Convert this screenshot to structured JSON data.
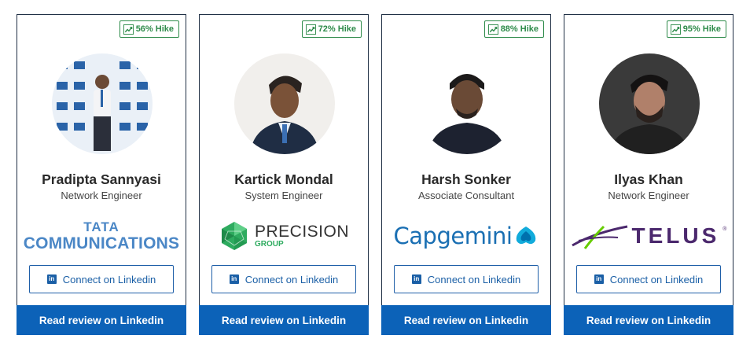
{
  "cards": [
    {
      "hike": "56% Hike",
      "name": "Pradipta Sannyasi",
      "role": "Network Engineer",
      "company_logo": "TATA COMMUNICATIONS",
      "logo_lines": [
        "TATA",
        "COMMUNICATIONS"
      ],
      "connect_label": "Connect on Linkedin",
      "review_label": "Read review on Linkedin"
    },
    {
      "hike": "72% Hike",
      "name": "Kartick Mondal",
      "role": "System Engineer",
      "company_logo": "PRECISION GROUP",
      "logo_lines": [
        "PRECISION",
        "GROUP"
      ],
      "connect_label": "Connect on Linkedin",
      "review_label": "Read review on Linkedin"
    },
    {
      "hike": "88% Hike",
      "name": "Harsh Sonker",
      "role": "Associate Consultant",
      "company_logo": "Capgemini",
      "logo_lines": [
        "Capgemini"
      ],
      "connect_label": "Connect on Linkedin",
      "review_label": "Read review on Linkedin"
    },
    {
      "hike": "95% Hike",
      "name": "Ilyas Khan",
      "role": "Network Engineer",
      "company_logo": "TELUS",
      "logo_lines": [
        "TELUS"
      ],
      "connect_label": "Connect on Linkedin",
      "review_label": "Read review on Linkedin"
    }
  ],
  "icons": {
    "hike": "trending-up-icon",
    "linkedin": "linkedin-icon"
  },
  "colors": {
    "hike_green": "#2e8b4a",
    "linkedin_blue": "#0c62b8",
    "card_border": "#1f2f44"
  }
}
